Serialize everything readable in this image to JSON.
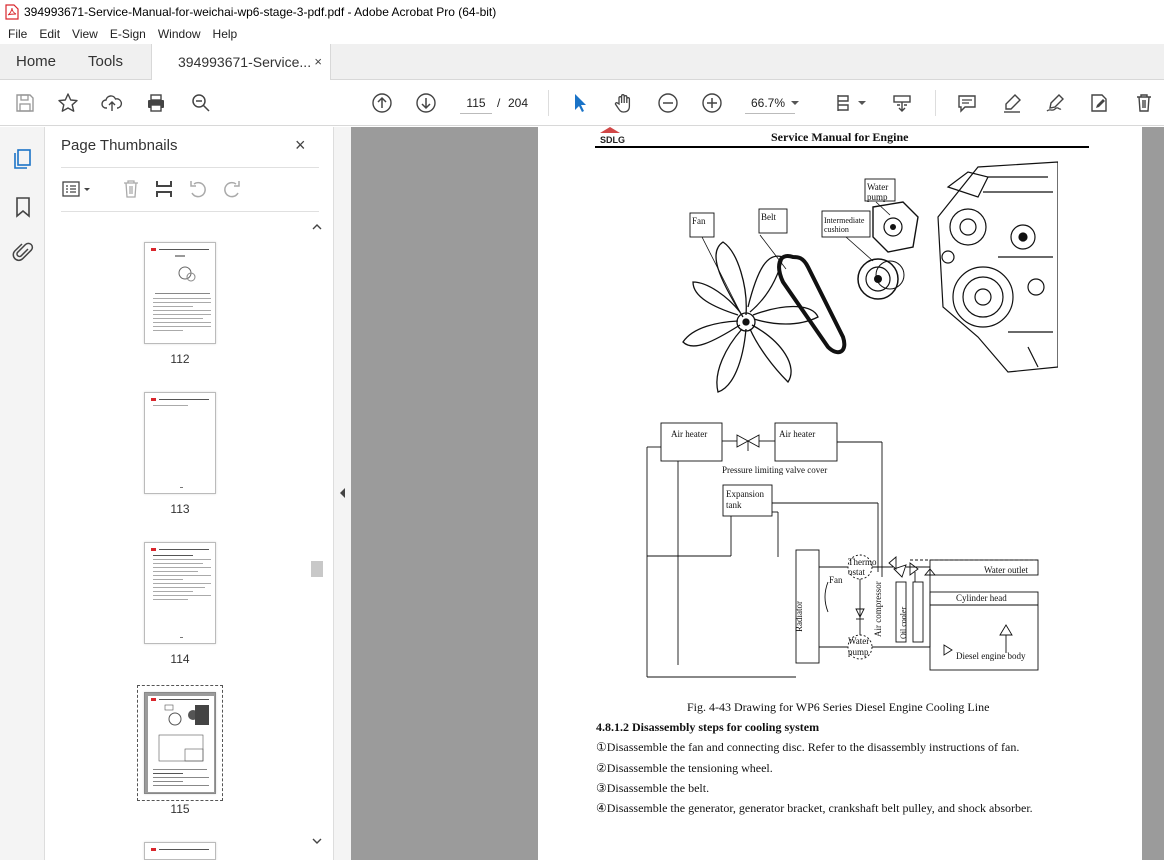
{
  "window": {
    "title": "394993671-Service-Manual-for-weichai-wp6-stage-3-pdf.pdf - Adobe Acrobat Pro (64-bit)"
  },
  "menu": [
    "File",
    "Edit",
    "View",
    "E-Sign",
    "Window",
    "Help"
  ],
  "tabs": {
    "home": "Home",
    "tools": "Tools",
    "document": "394993671-Service...",
    "close_glyph": "×"
  },
  "toolbar": {
    "current_page": "115",
    "page_separator": "/",
    "total_pages": "204",
    "zoom": "66.7%"
  },
  "thumbnails_panel": {
    "title": "Page Thumbnails",
    "close_glyph": "×",
    "pages": [
      {
        "label": "112",
        "selected": false
      },
      {
        "label": "113",
        "selected": false
      },
      {
        "label": "114",
        "selected": false
      },
      {
        "label": "115",
        "selected": true
      }
    ]
  },
  "document_page": {
    "header_title": "Service Manual for Engine",
    "logo_text": "SDLG",
    "exploded_view_labels": {
      "fan": "Fan",
      "belt": "Belt",
      "intermediate_cushion": [
        "Intermediate",
        "cushion"
      ],
      "water_pump": [
        "Water",
        "pump"
      ]
    },
    "cooling_diagram_labels": {
      "air_heater_left": "Air heater",
      "air_heater_right": "Air heater",
      "pressure_valve": "Pressure limiting valve cover",
      "expansion_tank": [
        "Expansion",
        "tank"
      ],
      "radiator": "Radiator",
      "fan": "Fan",
      "thermostat": [
        "Thermo",
        "ostat"
      ],
      "water_pump": [
        "Water",
        "pump"
      ],
      "air_compressor": "Air compressor",
      "oil_cooler": "Oil cooler",
      "water_outlet": "Water outlet",
      "cylinder_head": "Cylinder head",
      "engine_body": "Diesel engine body"
    },
    "figure_caption": "Fig. 4-43 Drawing for WP6 Series Diesel Engine Cooling Line",
    "section_heading": "4.8.1.2 Disassembly steps for cooling system",
    "steps": [
      "①Disassemble the fan and connecting disc. Refer to the disassembly instructions of fan.",
      "②Disassemble the tensioning wheel.",
      "③Disassemble the belt.",
      "④Disassemble the generator, generator bracket, crankshaft belt pulley, and shock absorber."
    ]
  },
  "colors": {
    "accent_blue": "#1a73c7",
    "pdf_red": "#d9262c",
    "viewer_bg": "#9b9b9b"
  }
}
